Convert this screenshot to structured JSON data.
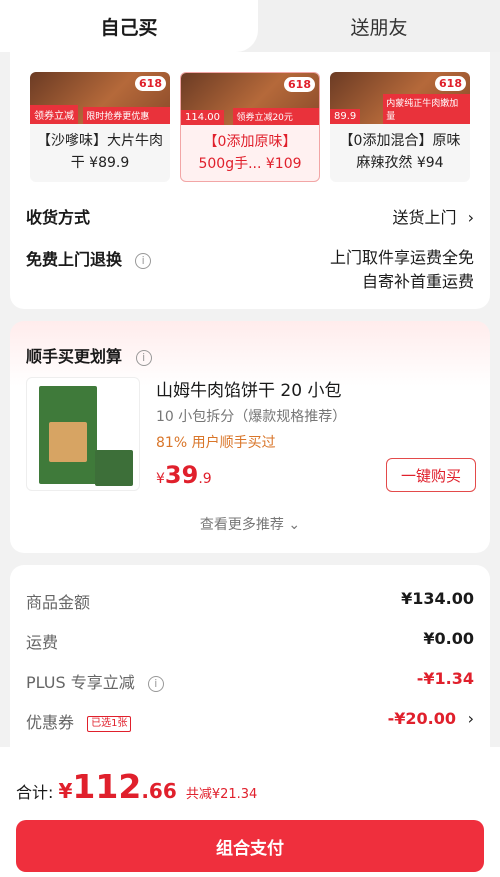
{
  "tabs": [
    {
      "label": "自己买"
    },
    {
      "label": "送朋友"
    }
  ],
  "products": [
    {
      "text": "【沙嗲味】大片牛肉干 ¥89.9",
      "badge": "618",
      "coupon": "领券立减",
      "promo": "限时抢券更优惠"
    },
    {
      "text": "【0添加原味】500g手... ¥109",
      "badge": "618",
      "price_tag": "114.00",
      "promo": "领券立减20元"
    },
    {
      "text": "【0添加混合】原味麻辣孜然 ¥94",
      "badge": "618",
      "price_tag": "89.9",
      "promo": "内蒙纯正牛肉嫩加量"
    }
  ],
  "delivery": {
    "label": "收货方式",
    "value": "送货上门"
  },
  "returns": {
    "label": "免费上门退换",
    "line1": "上门取件享运费全免",
    "line2": "自寄补首重运费"
  },
  "addon": {
    "title": "顺手买更划算",
    "name": "山姆牛肉馅饼干 20 小包",
    "subtitle": "10 小包拆分（爆款规格推荐）",
    "percent": "81% 用户顺手买过",
    "currency": "¥",
    "price_int": "39",
    "price_dec": ".9",
    "buy_label": "一键购买",
    "more_label": "查看更多推荐"
  },
  "fees": {
    "goods_label": "商品金额",
    "goods_value": "¥134.00",
    "ship_label": "运费",
    "ship_value": "¥0.00",
    "plus_label": "PLUS 专享立减",
    "plus_value": "-¥1.34",
    "coupon_label": "优惠券",
    "coupon_chosen": "已选1张",
    "coupon_value": "-¥20.00"
  },
  "footer": {
    "total_label": "合计:",
    "currency": "¥",
    "total_int": "112",
    "total_dec": ".66",
    "saved": "共减¥21.34",
    "pay_label": "组合支付"
  },
  "colors": {
    "accent": "#e0202c",
    "button": "#ef2f3d",
    "highlight": "#d9762a"
  }
}
